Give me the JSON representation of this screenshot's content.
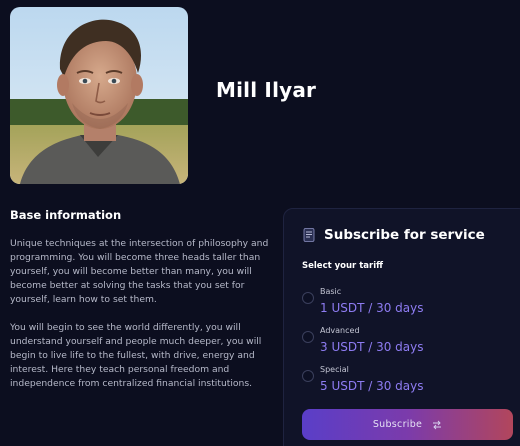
{
  "profile": {
    "name": "Mill Ilyar"
  },
  "about": {
    "title": "Base information",
    "paragraphs": [
      "Unique techniques at the intersection of philosophy and programming. You will become three heads taller than yourself, you will become better than many, you will become better at solving the tasks that you set for yourself, learn how to set them.",
      "You will begin to see the world differently, you will understand yourself and people much deeper, you will begin to live life to the fullest, with drive, energy and interest. Here they teach personal freedom and independence from centralized financial institutions."
    ]
  },
  "subscribe": {
    "title": "Subscribe for service",
    "icon": "document-icon",
    "select_label": "Select your tariff",
    "tariffs": [
      {
        "name": "Basic",
        "price": "1 USDT / 30 days",
        "selected": false
      },
      {
        "name": "Advanced",
        "price": "3 USDT / 30 days",
        "selected": false
      },
      {
        "name": "Special",
        "price": "5 USDT / 30 days",
        "selected": false
      }
    ],
    "button_label": "Subscribe",
    "button_icon": "arrows-icon"
  },
  "colors": {
    "background": "#0c0e1f",
    "card": "#101328",
    "accent_price": "#8e7cf2",
    "button_gradient_start": "#5a3ec8",
    "button_gradient_end": "#b2465c"
  }
}
